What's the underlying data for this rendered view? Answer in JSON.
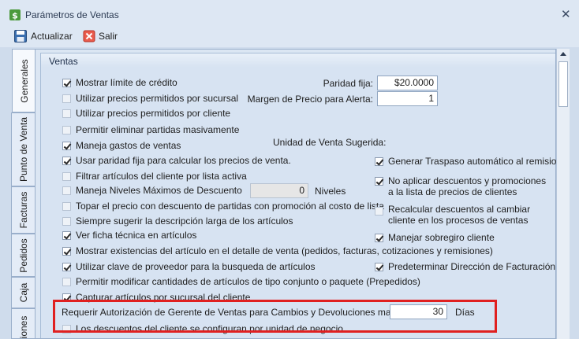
{
  "window": {
    "title": "Parámetros de Ventas",
    "close_glyph": "✕",
    "icon": "app-dollar-icon"
  },
  "toolbar": {
    "actualizar_label": "Actualizar",
    "actualizar_icon": "save-disk-icon",
    "salir_label": "Salir",
    "salir_icon": "exit-red-x-icon"
  },
  "tabs": [
    {
      "label": "Generales",
      "active": true
    },
    {
      "label": "Punto de Venta",
      "active": false
    },
    {
      "label": "Facturas",
      "active": false
    },
    {
      "label": "Pedidos",
      "active": false
    },
    {
      "label": "Caja",
      "active": false
    },
    {
      "label": "iones",
      "active": false
    }
  ],
  "section": {
    "title": "Ventas"
  },
  "left_checks": [
    {
      "label": "Mostrar límite de crédito",
      "checked": true
    },
    {
      "label": "Utilizar precios permitidos por sucursal",
      "checked": false
    },
    {
      "label": "Utilizar precios permitidos por cliente",
      "checked": false
    },
    {
      "label": "Permitir eliminar partidas masivamente",
      "checked": false
    },
    {
      "label": "Maneja gastos de ventas",
      "checked": true
    },
    {
      "label": "Usar paridad fija para calcular los precios de venta.",
      "checked": true
    },
    {
      "label": "Filtrar artículos del cliente por lista activa",
      "checked": false
    },
    {
      "label": "Maneja Niveles Máximos de Descuento",
      "checked": false
    },
    {
      "label": "Topar el precio con descuento de partidas con promoción al costo de lista",
      "checked": false
    },
    {
      "label": "Siempre sugerir la descripción larga de los artículos",
      "checked": false
    },
    {
      "label": "Ver ficha técnica en artículos",
      "checked": true
    },
    {
      "label": "Mostrar existencias del artículo en el detalle de venta (pedidos, facturas, cotizaciones y remisiones)",
      "checked": true
    },
    {
      "label": "Utilizar clave de proveedor para la busqueda de artículos",
      "checked": true
    },
    {
      "label": "Permitir modificar cantidades de artículos de tipo conjunto o paquete (Prepedidos)",
      "checked": false
    },
    {
      "label": "Capturar artículos por sucursal del cliente",
      "checked": true
    }
  ],
  "niveles": {
    "value": "0",
    "unit": "Niveles"
  },
  "paridad": {
    "label": "Paridad fija:",
    "value": "$20.0000"
  },
  "margen": {
    "label": "Margen de Precio para Alerta:",
    "value": "1"
  },
  "unidad_label": "Unidad de Venta Sugerida:",
  "right_checks": [
    {
      "label": "Generar Traspaso automático al remisionar",
      "checked": true
    },
    {
      "label": "No aplicar descuentos y promociones a la lista de precios de clientes",
      "checked": true
    },
    {
      "label": "Recalcular descuentos al cambiar cliente en los procesos de ventas",
      "checked": false
    },
    {
      "label": "Manejar sobregiro cliente",
      "checked": true
    },
    {
      "label": "Predeterminar Dirección de Facturación",
      "checked": true
    }
  ],
  "autorizacion": {
    "label": "Requerir Autorización de Gerente de Ventas para Cambios y Devoluciones mayores a",
    "value": "30",
    "unit": "Días"
  },
  "last_check": {
    "label": "Los descuentos del cliente se configuran por unidad de negocio",
    "checked": false
  },
  "colors": {
    "highlight": "#e02020",
    "background": "#cfdcec"
  }
}
